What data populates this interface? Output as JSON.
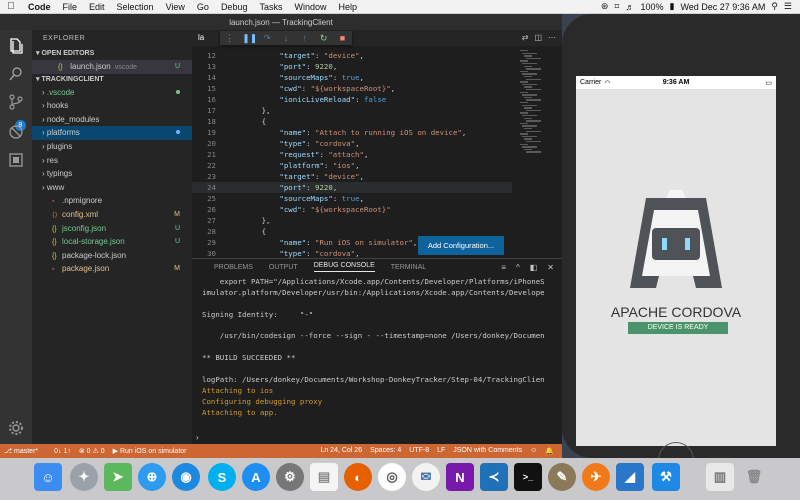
{
  "menubar": {
    "app": "Code",
    "items": [
      "File",
      "Edit",
      "Selection",
      "View",
      "Go",
      "Debug",
      "Tasks",
      "Window",
      "Help"
    ],
    "battery": "100%",
    "clock": "Wed Dec 27  9:36 AM"
  },
  "window": {
    "title": "launch.json — TrackingClient"
  },
  "activity": {
    "scm_badge": "8"
  },
  "sidebar": {
    "title": "EXPLORER",
    "open_editors_label": "OPEN EDITORS",
    "open_editor": {
      "name": "launch.json",
      "folder": ".vscode",
      "status": "U"
    },
    "project_label": "TRACKINGCLIENT",
    "items": [
      {
        "label": ".vscode",
        "status": ""
      },
      {
        "label": "hooks",
        "status": ""
      },
      {
        "label": "node_modules",
        "status": ""
      },
      {
        "label": "platforms",
        "status": ""
      },
      {
        "label": "plugins",
        "status": ""
      },
      {
        "label": "res",
        "status": ""
      },
      {
        "label": "typings",
        "status": ""
      },
      {
        "label": "www",
        "status": ""
      },
      {
        "label": ".npmignore",
        "status": ""
      },
      {
        "label": "config.xml",
        "status": "M"
      },
      {
        "label": "jsconfig.json",
        "status": "U"
      },
      {
        "label": "local-storage.json",
        "status": "U"
      },
      {
        "label": "package-lock.json",
        "status": ""
      },
      {
        "label": "package.json",
        "status": "M"
      }
    ]
  },
  "editor": {
    "tab_label": "la",
    "lines": [
      {
        "n": "12",
        "t": "            \"target\": \"device\","
      },
      {
        "n": "13",
        "t": "            \"port\": 9220,"
      },
      {
        "n": "14",
        "t": "            \"sourceMaps\": true,"
      },
      {
        "n": "15",
        "t": "            \"cwd\": \"${workspaceRoot}\","
      },
      {
        "n": "16",
        "t": "            \"ionicLiveReload\": false"
      },
      {
        "n": "17",
        "t": "        },"
      },
      {
        "n": "18",
        "t": "        {"
      },
      {
        "n": "19",
        "t": "            \"name\": \"Attach to running iOS on device\","
      },
      {
        "n": "20",
        "t": "            \"type\": \"cordova\","
      },
      {
        "n": "21",
        "t": "            \"request\": \"attach\","
      },
      {
        "n": "22",
        "t": "            \"platform\": \"ios\","
      },
      {
        "n": "23",
        "t": "            \"target\": \"device\","
      },
      {
        "n": "24",
        "t": "            \"port\": 9220,"
      },
      {
        "n": "25",
        "t": "            \"sourceMaps\": true,"
      },
      {
        "n": "26",
        "t": "            \"cwd\": \"${workspaceRoot}\""
      },
      {
        "n": "27",
        "t": "        },"
      },
      {
        "n": "28",
        "t": "        {"
      },
      {
        "n": "29",
        "t": "            \"name\": \"Run iOS on simulator\","
      },
      {
        "n": "30",
        "t": "            \"type\": \"cordova\","
      }
    ],
    "add_configuration": "Add Configuration..."
  },
  "panel": {
    "tabs": [
      "PROBLEMS",
      "OUTPUT",
      "DEBUG CONSOLE",
      "TERMINAL"
    ],
    "active_tab": "DEBUG CONSOLE",
    "lines": [
      {
        "t": "    export PATH=\"/Applications/Xcode.app/Contents/Developer/Platforms/iPhoneS",
        "c": ""
      },
      {
        "t": "imulator.platform/Developer/usr/bin:/Applications/Xcode.app/Contents/Develope",
        "c": ""
      },
      {
        "t": "",
        "c": ""
      },
      {
        "t": "Signing Identity:     \"-\"",
        "c": ""
      },
      {
        "t": "",
        "c": ""
      },
      {
        "t": "    /usr/bin/codesign --force --sign - --timestamp=none /Users/donkey/Documen",
        "c": ""
      },
      {
        "t": "",
        "c": ""
      },
      {
        "t": "** BUILD SUCCEEDED **",
        "c": ""
      },
      {
        "t": "",
        "c": ""
      },
      {
        "t": "logPath: /Users/donkey/Documents/Workshop-DonkeyTracker/Step-04/TrackingClien",
        "c": ""
      },
      {
        "t": "Attaching to ios",
        "c": "o"
      },
      {
        "t": "Configuring debugging proxy",
        "c": "o"
      },
      {
        "t": "Attaching to app.",
        "c": "o"
      }
    ],
    "prompt": "›"
  },
  "statusbar": {
    "branch": "master*",
    "sync": "0↓ 1↑",
    "problems": "⊗ 0 ⚠ 0",
    "launch": "Run iOS on simulator",
    "position": "Ln 24, Col 26",
    "spaces": "Spaces: 4",
    "encoding": "UTF-8",
    "eol": "LF",
    "language": "JSON with Comments"
  },
  "simulator": {
    "carrier": "Carrier",
    "time": "9:36 AM",
    "app_title": "APACHE CORDOVA",
    "status": "DEVICE IS READY"
  },
  "colors": {
    "statusbar": "#cc6633",
    "accent_button": "#0e639c",
    "device_ready": "#4b946a"
  }
}
